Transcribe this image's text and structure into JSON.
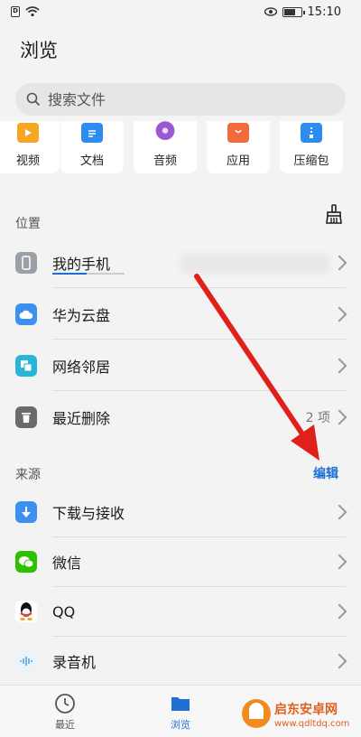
{
  "status": {
    "time": "15:10",
    "sim": "D"
  },
  "header": {
    "title": "浏览"
  },
  "search": {
    "placeholder": "搜索文件"
  },
  "categories": [
    {
      "label": "视频",
      "icon": "video-icon",
      "color": "#f5a623"
    },
    {
      "label": "文档",
      "icon": "document-icon",
      "color": "#2d8cf0"
    },
    {
      "label": "音频",
      "icon": "audio-icon",
      "color": "#9b59d0"
    },
    {
      "label": "应用",
      "icon": "app-icon",
      "color": "#f26b3a"
    },
    {
      "label": "压缩包",
      "icon": "archive-icon",
      "color": "#2d8cf0"
    }
  ],
  "location": {
    "title": "位置",
    "items": [
      {
        "label": "我的手机",
        "icon": "phone-icon",
        "color": "#9aa0a6"
      },
      {
        "label": "华为云盘",
        "icon": "cloud-icon",
        "color": "#3d8ff0"
      },
      {
        "label": "网络邻居",
        "icon": "network-icon",
        "color": "#28b5d6"
      },
      {
        "label": "最近删除",
        "icon": "trash-icon",
        "color": "#6b6b6b",
        "extra": "2 项"
      }
    ]
  },
  "source": {
    "title": "来源",
    "edit_label": "编辑",
    "items": [
      {
        "label": "下载与接收",
        "icon": "download-icon",
        "color": "#3d8ff0"
      },
      {
        "label": "微信",
        "icon": "wechat-icon",
        "color": "#2dc100"
      },
      {
        "label": "QQ",
        "icon": "qq-icon",
        "color": "#000000"
      },
      {
        "label": "录音机",
        "icon": "recorder-icon",
        "color": "#4aa3e0"
      }
    ]
  },
  "bottom_nav": [
    {
      "label": "最近",
      "icon": "clock-icon"
    },
    {
      "label": "浏览",
      "icon": "folder-icon",
      "active": true
    }
  ],
  "accent": "#1f6fd6",
  "annotation_color": "#e0201b"
}
